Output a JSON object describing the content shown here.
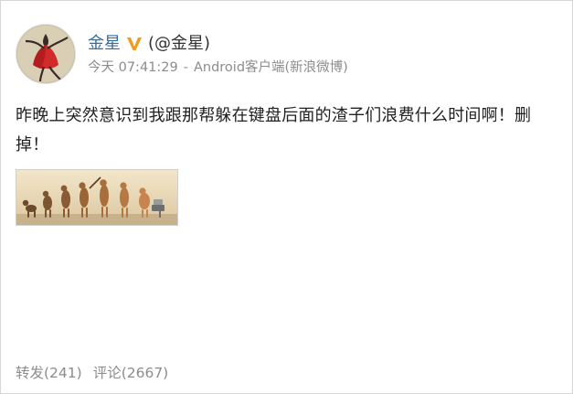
{
  "post": {
    "author": {
      "name": "金星",
      "handle": "(@金星)"
    },
    "meta": {
      "time": "今天 07:41:29",
      "separator": "-",
      "source": "Android客户端(新浪微博)"
    },
    "text": "昨晚上突然意识到我跟那帮躲在键盘后面的渣子们浪费什么时间啊！删掉！",
    "image_icon": "evolution-image",
    "actions": {
      "repost": "转发(241)",
      "comment": "评论(2667)"
    }
  },
  "colors": {
    "name_link": "#2f6ea5",
    "verified_badge": "#f29b1b",
    "meta_gray": "#8c8c8c",
    "border": "#d7d7d7"
  }
}
